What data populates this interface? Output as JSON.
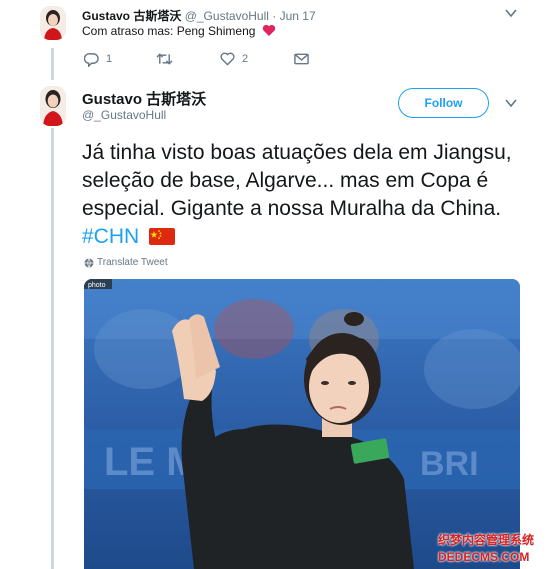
{
  "tweet1": {
    "author_name": "Gustavo 古斯塔沃",
    "handle": "@_GustavoHull",
    "date": "Jun 17",
    "text": "Com atraso mas: Peng Shimeng",
    "reply_count": "1",
    "like_count": "2"
  },
  "tweet2": {
    "author_name": "Gustavo 古斯塔沃",
    "handle": "@_GustavoHull",
    "follow_label": "Follow",
    "text": "Já tinha visto boas atuações dela em Jiangsu, seleção de base, Algarve... mas em Copa é especial. Gigante a nossa Muralha da China.",
    "hashtag": "#CHN",
    "translate_label": "Translate Tweet"
  },
  "watermark": {
    "line1": "织梦内容管理系统",
    "line2": "DEDECMS.COM"
  },
  "colors": {
    "accent": "#1da1f2",
    "heart": "#e0245e",
    "secondary_text": "#657786"
  }
}
